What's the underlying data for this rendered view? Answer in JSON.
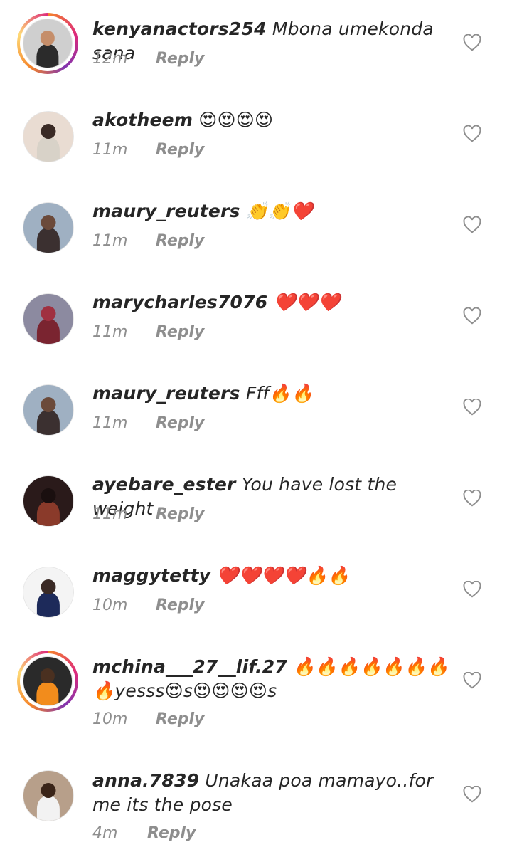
{
  "comments": [
    {
      "username": "kenyanactors254",
      "text": "Mbona umekonda sana",
      "time": "12m",
      "reply": "Reply",
      "story_ring": true,
      "avatar_colors": [
        "#cfcfcf",
        "#2b2b2b",
        "#c58e6a"
      ]
    },
    {
      "username": "akotheem",
      "text": "😍😍😍😍",
      "time": "11m",
      "reply": "Reply",
      "story_ring": false,
      "avatar_colors": [
        "#e9dcd2",
        "#d8d2c8",
        "#3a2a25"
      ]
    },
    {
      "username": "maury_reuters",
      "text": "👏👏❤️",
      "time": "11m",
      "reply": "Reply",
      "story_ring": false,
      "avatar_colors": [
        "#9fb0c2",
        "#3b3030",
        "#6b4a3a"
      ]
    },
    {
      "username": "marycharles7076",
      "text": "❤️❤️❤️",
      "time": "11m",
      "reply": "Reply",
      "story_ring": false,
      "avatar_colors": [
        "#8c8aa0",
        "#7a2430",
        "#a03040"
      ]
    },
    {
      "username": "maury_reuters",
      "text": "Fff🔥🔥",
      "time": "11m",
      "reply": "Reply",
      "story_ring": false,
      "avatar_colors": [
        "#9fb0c2",
        "#3b3030",
        "#6b4a3a"
      ]
    },
    {
      "username": "ayebare_ester",
      "text": "You have lost the weight",
      "time": "11m",
      "reply": "Reply",
      "story_ring": false,
      "avatar_colors": [
        "#2a1a1a",
        "#8a3a2a",
        "#1a0f0f"
      ]
    },
    {
      "username": "maggytetty",
      "text": "❤️❤️❤️❤️🔥🔥",
      "time": "10m",
      "reply": "Reply",
      "story_ring": false,
      "avatar_colors": [
        "#f4f4f4",
        "#1d2a5a",
        "#3a2a25"
      ]
    },
    {
      "username": "mchina___27__lif.27",
      "text": "🔥🔥🔥🔥🔥🔥🔥🔥yesss😍s😍😍😍😍s",
      "time": "10m",
      "reply": "Reply",
      "story_ring": true,
      "avatar_colors": [
        "#2a2a2a",
        "#f28c1c",
        "#4a3020"
      ]
    },
    {
      "username": "anna.7839",
      "text": "Unakaa poa mamayo..for me its the pose",
      "time": "4m",
      "reply": "Reply",
      "story_ring": false,
      "avatar_colors": [
        "#b79f8a",
        "#f2f2f2",
        "#3a2418"
      ]
    }
  ],
  "icons": {
    "like": "heart-outline-icon"
  },
  "colors": {
    "text": "#262626",
    "meta": "#8e8e8e"
  }
}
